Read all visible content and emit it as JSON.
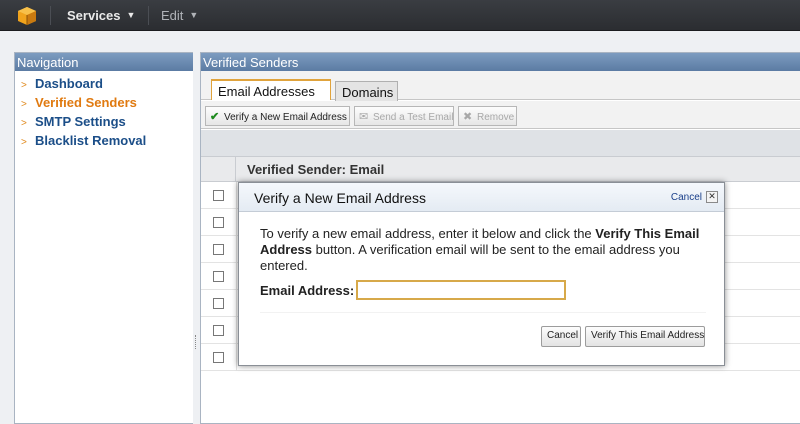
{
  "topbar": {
    "services_label": "Services",
    "edit_label": "Edit"
  },
  "nav": {
    "title": "Navigation",
    "items": [
      {
        "label": "Dashboard",
        "active": false
      },
      {
        "label": "Verified Senders",
        "active": true
      },
      {
        "label": "SMTP Settings",
        "active": false
      },
      {
        "label": "Blacklist Removal",
        "active": false
      }
    ]
  },
  "main": {
    "title": "Verified Senders",
    "tabs": [
      {
        "label": "Email Addresses",
        "active": true
      },
      {
        "label": "Domains",
        "active": false
      }
    ],
    "toolbar": {
      "verify_label": "Verify a New Email Address",
      "test_label": "Send a Test Email",
      "remove_label": "Remove"
    },
    "table": {
      "column_header": "Verified Sender: Email",
      "row_count": 7
    }
  },
  "dialog": {
    "title": "Verify a New Email Address",
    "cancel_link": "Cancel",
    "close_glyph": "✕",
    "message_pre": "To verify a new email address, enter it below and click the ",
    "message_bold": "Verify This Email Address",
    "message_post": " button. A verification email will be sent to the email address you entered.",
    "field_label": "Email Address:",
    "field_value": "",
    "cancel_button": "Cancel",
    "verify_button": "Verify This Email Address"
  },
  "colors": {
    "nav_link": "#1b4e88",
    "nav_active": "#e07a10",
    "panel_header": "#6a8bb3",
    "input_border": "#d7a94a"
  },
  "icons": {
    "logo": "aws-box-icon",
    "verify": "green-check-icon",
    "test": "email-icon",
    "remove": "remove-icon"
  }
}
